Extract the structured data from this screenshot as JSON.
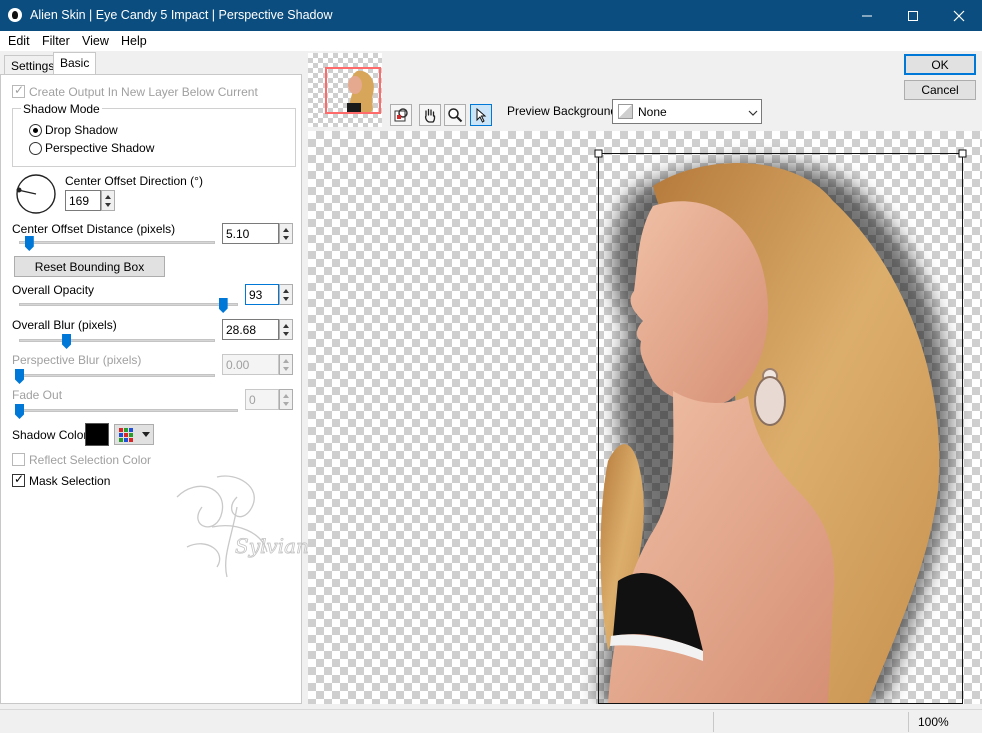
{
  "window": {
    "title": "Alien Skin | Eye Candy 5 Impact | Perspective Shadow"
  },
  "menu": [
    "Edit",
    "Filter",
    "View",
    "Help"
  ],
  "tabs": {
    "settings": "Settings",
    "basic": "Basic"
  },
  "dialog_buttons": {
    "ok": "OK",
    "cancel": "Cancel"
  },
  "basic": {
    "create_output": {
      "label": "Create Output In New Layer Below Current",
      "checked": true,
      "enabled": false
    },
    "shadow_mode": {
      "label": "Shadow Mode",
      "options": [
        "Drop Shadow",
        "Perspective Shadow"
      ],
      "selected": "Drop Shadow"
    },
    "center_offset_direction": {
      "label": "Center Offset Direction (°)",
      "value": "169"
    },
    "center_offset_distance": {
      "label": "Center Offset Distance (pixels)",
      "value": "5.10",
      "level": 0.05
    },
    "reset_bounding_box": "Reset Bounding Box",
    "overall_opacity": {
      "label": "Overall Opacity",
      "value": "93",
      "level": 0.93
    },
    "overall_blur": {
      "label": "Overall Blur (pixels)",
      "value": "28.68",
      "level": 0.24
    },
    "perspective_blur": {
      "label": "Perspective Blur (pixels)",
      "value": "0.00",
      "level": 0,
      "enabled": false
    },
    "fade_out": {
      "label": "Fade Out",
      "value": "0",
      "level": 0,
      "enabled": false
    },
    "shadow_color": {
      "label": "Shadow Color",
      "color": "#000000"
    },
    "reflect_selection_color": {
      "label": "Reflect Selection Color",
      "checked": false,
      "enabled": false
    },
    "mask_selection": {
      "label": "Mask Selection",
      "checked": true
    }
  },
  "preview": {
    "background_label": "Preview Background:",
    "background_value": "None",
    "tools": [
      "navigate-icon",
      "hand-icon",
      "zoom-icon",
      "arrow-icon"
    ]
  },
  "status": {
    "zoom": "100%"
  },
  "colors": {
    "titlebar": "#0b4d7e",
    "accent": "#0078d7"
  }
}
